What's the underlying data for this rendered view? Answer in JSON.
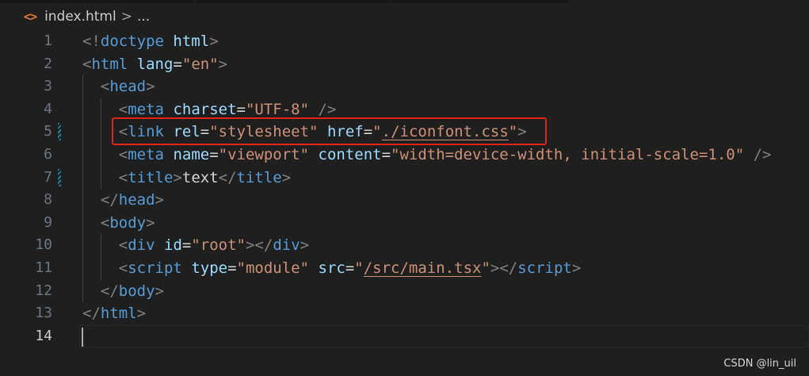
{
  "breadcrumb": {
    "icon": "<>",
    "file": "index.html",
    "separator": ">",
    "more": "..."
  },
  "editor": {
    "lines": [
      {
        "n": "1",
        "tokens": [
          [
            "p",
            "<!"
          ],
          [
            "k",
            "doctype"
          ],
          [
            "t",
            " "
          ],
          [
            "a",
            "html"
          ],
          [
            "p",
            ">"
          ]
        ]
      },
      {
        "n": "2",
        "tokens": [
          [
            "p",
            "<"
          ],
          [
            "k",
            "html"
          ],
          [
            "t",
            " "
          ],
          [
            "a",
            "lang"
          ],
          [
            "t",
            "="
          ],
          [
            "s",
            "\"en\""
          ],
          [
            "p",
            ">"
          ]
        ]
      },
      {
        "n": "3",
        "tokens": [
          [
            "t",
            "  "
          ],
          [
            "p",
            "<"
          ],
          [
            "k",
            "head"
          ],
          [
            "p",
            ">"
          ]
        ]
      },
      {
        "n": "4",
        "tokens": [
          [
            "t",
            "    "
          ],
          [
            "p",
            "<"
          ],
          [
            "k",
            "meta"
          ],
          [
            "t",
            " "
          ],
          [
            "a",
            "charset"
          ],
          [
            "t",
            "="
          ],
          [
            "s",
            "\"UTF-8\""
          ],
          [
            "t",
            " "
          ],
          [
            "p",
            "/>"
          ]
        ]
      },
      {
        "n": "5",
        "tokens": [
          [
            "t",
            "    "
          ],
          [
            "p",
            "<"
          ],
          [
            "k",
            "link"
          ],
          [
            "t",
            " "
          ],
          [
            "a",
            "rel"
          ],
          [
            "t",
            "="
          ],
          [
            "s",
            "\"stylesheet\""
          ],
          [
            "t",
            " "
          ],
          [
            "a",
            "href"
          ],
          [
            "t",
            "="
          ],
          [
            "s",
            "\""
          ],
          [
            "u",
            "./iconfont.css"
          ],
          [
            "s",
            "\""
          ],
          [
            "p",
            ">"
          ]
        ]
      },
      {
        "n": "6",
        "tokens": [
          [
            "t",
            "    "
          ],
          [
            "p",
            "<"
          ],
          [
            "k",
            "meta"
          ],
          [
            "t",
            " "
          ],
          [
            "a",
            "name"
          ],
          [
            "t",
            "="
          ],
          [
            "s",
            "\"viewport\""
          ],
          [
            "t",
            " "
          ],
          [
            "a",
            "content"
          ],
          [
            "t",
            "="
          ],
          [
            "s",
            "\"width=device-width, initial-scale=1.0\""
          ],
          [
            "t",
            " "
          ],
          [
            "p",
            "/>"
          ]
        ]
      },
      {
        "n": "7",
        "tokens": [
          [
            "t",
            "    "
          ],
          [
            "p",
            "<"
          ],
          [
            "k",
            "title"
          ],
          [
            "p",
            ">"
          ],
          [
            "t",
            "text"
          ],
          [
            "p",
            "</"
          ],
          [
            "k",
            "title"
          ],
          [
            "p",
            ">"
          ]
        ]
      },
      {
        "n": "8",
        "tokens": [
          [
            "t",
            "  "
          ],
          [
            "p",
            "</"
          ],
          [
            "k",
            "head"
          ],
          [
            "p",
            ">"
          ]
        ]
      },
      {
        "n": "9",
        "tokens": [
          [
            "t",
            "  "
          ],
          [
            "p",
            "<"
          ],
          [
            "k",
            "body"
          ],
          [
            "p",
            ">"
          ]
        ]
      },
      {
        "n": "10",
        "tokens": [
          [
            "t",
            "    "
          ],
          [
            "p",
            "<"
          ],
          [
            "k",
            "div"
          ],
          [
            "t",
            " "
          ],
          [
            "a",
            "id"
          ],
          [
            "t",
            "="
          ],
          [
            "s",
            "\"root\""
          ],
          [
            "p",
            "></"
          ],
          [
            "k",
            "div"
          ],
          [
            "p",
            ">"
          ]
        ]
      },
      {
        "n": "11",
        "tokens": [
          [
            "t",
            "    "
          ],
          [
            "p",
            "<"
          ],
          [
            "k",
            "script"
          ],
          [
            "t",
            " "
          ],
          [
            "a",
            "type"
          ],
          [
            "t",
            "="
          ],
          [
            "s",
            "\"module\""
          ],
          [
            "t",
            " "
          ],
          [
            "a",
            "src"
          ],
          [
            "t",
            "="
          ],
          [
            "s",
            "\""
          ],
          [
            "u",
            "/src/main.tsx"
          ],
          [
            "s",
            "\""
          ],
          [
            "p",
            "></"
          ],
          [
            "k",
            "script"
          ],
          [
            "p",
            ">"
          ]
        ]
      },
      {
        "n": "12",
        "tokens": [
          [
            "t",
            "  "
          ],
          [
            "p",
            "</"
          ],
          [
            "k",
            "body"
          ],
          [
            "p",
            ">"
          ]
        ]
      },
      {
        "n": "13",
        "tokens": [
          [
            "p",
            "</"
          ],
          [
            "k",
            "html"
          ],
          [
            "p",
            ">"
          ]
        ]
      },
      {
        "n": "14",
        "tokens": []
      }
    ],
    "modified_lines": [
      "5",
      "7"
    ],
    "active_line": "14"
  },
  "watermark": "CSDN @lin_uil",
  "colors": {
    "background": "#1f1f1f",
    "tag": "#569cd6",
    "attribute": "#9cdcfe",
    "string": "#ce9178",
    "punctuation": "#808080",
    "highlight_box": "#e2231a"
  }
}
